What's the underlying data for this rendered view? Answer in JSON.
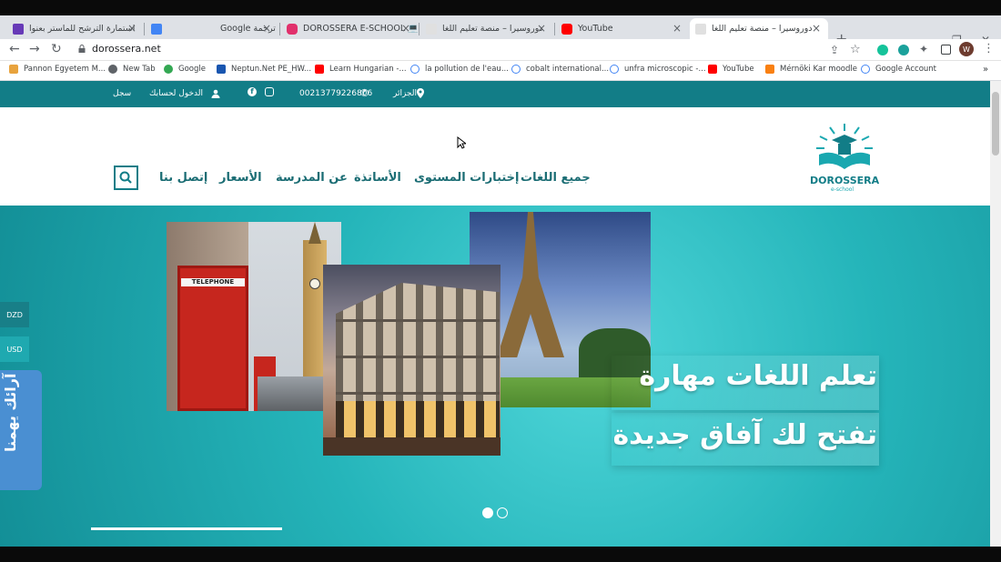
{
  "browser": {
    "tabs": [
      {
        "title": "استمارة الترشح للماستر بعنوا",
        "icon_color": "#673ab7",
        "icon": "forms-icon"
      },
      {
        "title": "ترجمة Google",
        "icon_color": "#4285f4",
        "icon": "translate-icon"
      },
      {
        "title": "DOROSSERA E-SCHOOL 💻",
        "icon_color": "#e1306c",
        "icon": "instagram-icon"
      },
      {
        "title": "دوروسيرا – منصة تعليم اللغا",
        "icon_color": "#e0e0e0",
        "icon": "site-icon"
      },
      {
        "title": "YouTube",
        "icon_color": "#ff0000",
        "icon": "youtube-icon"
      },
      {
        "title": "دوروسيرا – منصة تعليم اللغا",
        "icon_color": "#e0e0e0",
        "icon": "site-icon"
      }
    ],
    "url": "dorossera.net",
    "profile_initial": "W",
    "bookmarks": [
      {
        "label": "Pannon Egyetem M...",
        "icon_color": "#e8a33d"
      },
      {
        "label": "New Tab",
        "icon_color": "#5f6368"
      },
      {
        "label": "Google",
        "icon_color": "#34a853"
      },
      {
        "label": "Neptun.Net PE_HW...",
        "icon_color": "#1a56b0"
      },
      {
        "label": "Learn Hungarian -...",
        "icon_color": "#ff0000"
      },
      {
        "label": "la pollution de l'eau...",
        "icon_color": "#4285f4"
      },
      {
        "label": "cobalt international...",
        "icon_color": "#4285f4"
      },
      {
        "label": "unfra microscopic -...",
        "icon_color": "#4285f4"
      },
      {
        "label": "YouTube",
        "icon_color": "#ff0000"
      },
      {
        "label": "Mérnöki Kar moodle",
        "icon_color": "#f98012"
      },
      {
        "label": "Google Account",
        "icon_color": "#4285f4"
      }
    ]
  },
  "site": {
    "infobar": {
      "register": "سجل",
      "login": "الدخول لحسابك",
      "phone": "00213779226806",
      "location": "الجزائر"
    },
    "logo": {
      "name": "DOROSSERA",
      "tagline": "e-school"
    },
    "menu": [
      "جميع اللغات",
      "إختبارات المستوى",
      "الأساتذة",
      "عن المدرسة",
      "الأسعار",
      "إتصل بنا"
    ],
    "hero": {
      "line1": "تعلم اللغات مهارة",
      "line2": "تفتح لك آفاق جديدة"
    },
    "photos": {
      "phonebox_sign": "TELEPHONE"
    },
    "currencies": [
      "DZD",
      "USD"
    ],
    "feedback": "آرائك يهمنا"
  },
  "colors": {
    "brand": "#127d87",
    "hero": "#25b5ba",
    "feedback": "#4a8fd2"
  }
}
